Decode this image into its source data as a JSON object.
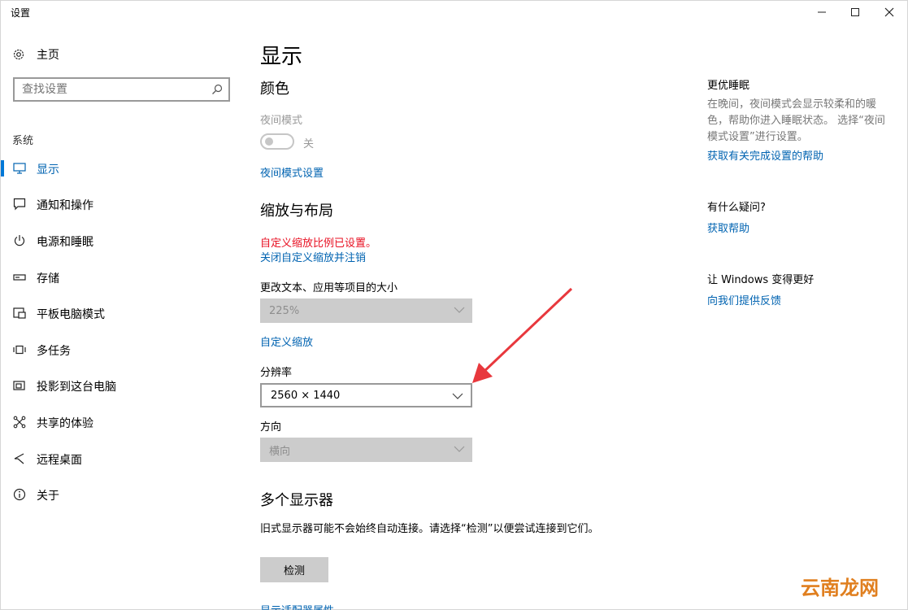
{
  "window": {
    "title": "设置",
    "minimize_icon": "minimize-icon",
    "maximize_icon": "maximize-icon",
    "close_icon": "close-icon"
  },
  "sidebar": {
    "home_label": "主页",
    "search_placeholder": "查找设置",
    "section_label": "系统",
    "items": [
      {
        "label": "显示",
        "icon": "monitor-icon",
        "active": true
      },
      {
        "label": "通知和操作",
        "icon": "notification-icon"
      },
      {
        "label": "电源和睡眠",
        "icon": "power-icon"
      },
      {
        "label": "存储",
        "icon": "storage-icon"
      },
      {
        "label": "平板电脑模式",
        "icon": "tablet-mode-icon"
      },
      {
        "label": "多任务",
        "icon": "multitasking-icon"
      },
      {
        "label": "投影到这台电脑",
        "icon": "projecting-icon"
      },
      {
        "label": "共享的体验",
        "icon": "shared-experiences-icon"
      },
      {
        "label": "远程桌面",
        "icon": "remote-desktop-icon"
      },
      {
        "label": "关于",
        "icon": "info-icon"
      }
    ]
  },
  "main": {
    "title": "显示",
    "color_section": {
      "heading": "颜色",
      "night_light_label": "夜间模式",
      "night_light_state": "关",
      "night_light_settings_link": "夜间模式设置"
    },
    "scale_section": {
      "heading": "缩放与布局",
      "custom_scale_warning": "自定义缩放比例已设置。",
      "turn_off_link": "关闭自定义缩放并注销",
      "text_size_label": "更改文本、应用等项目的大小",
      "text_size_value": "225%",
      "custom_scaling_link": "自定义缩放",
      "resolution_label": "分辨率",
      "resolution_value": "2560 × 1440",
      "orientation_label": "方向",
      "orientation_value": "横向"
    },
    "multi_display": {
      "heading": "多个显示器",
      "description": "旧式显示器可能不会始终自动连接。请选择“检测”以便尝试连接到它们。",
      "detect_button": "检测",
      "adapter_link": "显示适配器属性"
    }
  },
  "right_panel": {
    "sleep_heading": "更优睡眠",
    "sleep_text": "在晚间，夜间模式会显示较柔和的暖色，帮助你进入睡眠状态。 选择“夜间模式设置”进行设置。",
    "sleep_link": "获取有关完成设置的帮助",
    "question_heading": "有什么疑问?",
    "help_link": "获取帮助",
    "improve_heading": "让 Windows 变得更好",
    "feedback_link": "向我们提供反馈"
  },
  "watermark": {
    "text": "云南龙网"
  },
  "colors": {
    "accent": "#0078d7",
    "link": "#0063b1",
    "warning": "#e81123",
    "arrow": "#e8383d"
  }
}
